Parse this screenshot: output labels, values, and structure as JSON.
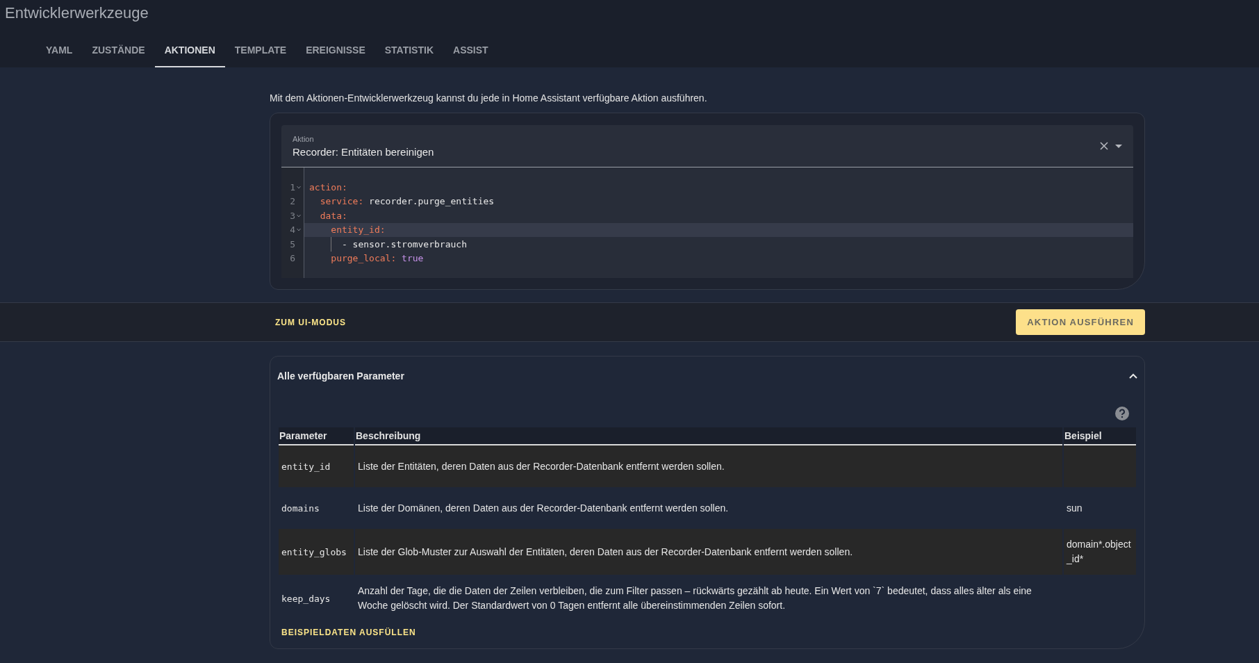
{
  "title": "Entwicklerwerkzeuge",
  "tabs": [
    {
      "label": "YAML",
      "selected": false
    },
    {
      "label": "ZUSTÄNDE",
      "selected": false
    },
    {
      "label": "AKTIONEN",
      "selected": true
    },
    {
      "label": "TEMPLATE",
      "selected": false
    },
    {
      "label": "EREIGNISSE",
      "selected": false
    },
    {
      "label": "STATISTIK",
      "selected": false
    },
    {
      "label": "ASSIST",
      "selected": false
    }
  ],
  "intro": "Mit dem Aktionen-Entwicklerwerkzeug kannst du jede in Home Assistant verfügbare Aktion ausführen.",
  "action_field": {
    "label": "Aktion",
    "value": "Recorder: Entitäten bereinigen"
  },
  "editor": {
    "lines": [
      {
        "number": "1",
        "fold": true,
        "active": false,
        "guide": false,
        "tokens": [
          {
            "kind": "key",
            "text": "action"
          },
          {
            "kind": "punct",
            "text": ":"
          }
        ]
      },
      {
        "number": "2",
        "fold": false,
        "active": false,
        "guide": false,
        "tokens": [
          {
            "kind": "key",
            "text": "  service"
          },
          {
            "kind": "punct",
            "text": ":"
          },
          {
            "kind": "value",
            "text": " recorder.purge_entities"
          }
        ]
      },
      {
        "number": "3",
        "fold": true,
        "active": false,
        "guide": false,
        "tokens": [
          {
            "kind": "key",
            "text": "  data"
          },
          {
            "kind": "punct",
            "text": ":"
          }
        ]
      },
      {
        "number": "4",
        "fold": true,
        "active": true,
        "guide": false,
        "tokens": [
          {
            "kind": "key",
            "text": "    entity_id"
          },
          {
            "kind": "punct",
            "text": ":"
          }
        ]
      },
      {
        "number": "5",
        "fold": false,
        "active": false,
        "guide": true,
        "tokens": [
          {
            "kind": "value",
            "text": "      - sensor.stromverbrauch"
          }
        ]
      },
      {
        "number": "6",
        "fold": false,
        "active": false,
        "guide": false,
        "tokens": [
          {
            "kind": "key",
            "text": "    purge_local"
          },
          {
            "kind": "punct",
            "text": ":"
          },
          {
            "kind": "bool",
            "text": " true"
          }
        ]
      }
    ]
  },
  "mode_link": "ZUM UI-MODUS",
  "run_button": "AKTION AUSFÜHREN",
  "params": {
    "title": "Alle verfügbaren Parameter",
    "expanded": true,
    "columns": [
      "Parameter",
      "Beschreibung",
      "Beispiel"
    ],
    "rows": [
      {
        "parameter": "entity_id",
        "description": "Liste der Entitäten, deren Daten aus der Recorder-Datenbank entfernt werden sollen."
      },
      {
        "parameter": "domains",
        "description": "Liste der Domänen, deren Daten aus der Recorder-Datenbank entfernt werden sollen.",
        "example": "sun"
      },
      {
        "parameter": "entity_globs",
        "description": "Liste der Glob-Muster zur Auswahl der Entitäten, deren Daten aus der Recorder-Datenbank entfernt werden sollen.",
        "example": "domain*.object_id*"
      },
      {
        "parameter": "keep_days",
        "description": "Anzahl der Tage, die die Daten der Zeilen verbleiben, die zum Filter passen – rückwärts gezählt ab heute. Ein Wert von `7` bedeutet, dass alles älter als eine Woche gelöscht wird. Der Standardwert von 0 Tagen entfernt alle übereinstimmenden Zeilen sofort."
      }
    ],
    "fill_button": "BEISPIELDATEN AUSFÜLLEN"
  }
}
